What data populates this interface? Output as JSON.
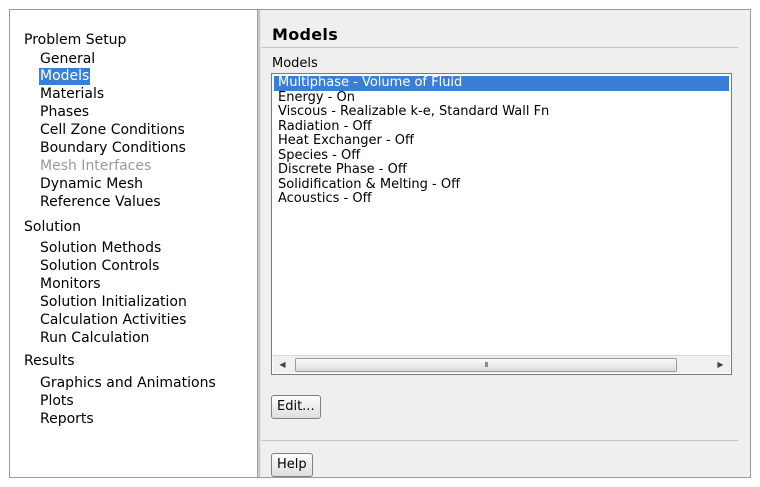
{
  "nav": {
    "sections": [
      {
        "label": "Problem Setup",
        "items": [
          {
            "label": "General",
            "state": "normal"
          },
          {
            "label": "Models",
            "state": "selected"
          },
          {
            "label": "Materials",
            "state": "normal"
          },
          {
            "label": "Phases",
            "state": "normal"
          },
          {
            "label": "Cell Zone Conditions",
            "state": "normal"
          },
          {
            "label": "Boundary Conditions",
            "state": "normal"
          },
          {
            "label": "Mesh Interfaces",
            "state": "disabled"
          },
          {
            "label": "Dynamic Mesh",
            "state": "normal"
          },
          {
            "label": "Reference Values",
            "state": "normal"
          }
        ]
      },
      {
        "label": "Solution",
        "items": [
          {
            "label": "Solution Methods",
            "state": "normal"
          },
          {
            "label": "Solution Controls",
            "state": "normal"
          },
          {
            "label": "Monitors",
            "state": "normal"
          },
          {
            "label": "Solution Initialization",
            "state": "normal"
          },
          {
            "label": "Calculation Activities",
            "state": "normal"
          },
          {
            "label": "Run Calculation",
            "state": "normal"
          }
        ]
      },
      {
        "label": "Results",
        "items": [
          {
            "label": "Graphics and Animations",
            "state": "normal"
          },
          {
            "label": "Plots",
            "state": "normal"
          },
          {
            "label": "Reports",
            "state": "normal"
          }
        ]
      }
    ]
  },
  "panel": {
    "title": "Models",
    "group_label": "Models",
    "models": [
      {
        "label": "Multiphase - Volume of Fluid",
        "selected": true
      },
      {
        "label": "Energy - On",
        "selected": false
      },
      {
        "label": "Viscous - Realizable k-e, Standard Wall Fn",
        "selected": false
      },
      {
        "label": "Radiation - Off",
        "selected": false
      },
      {
        "label": "Heat Exchanger - Off",
        "selected": false
      },
      {
        "label": "Species - Off",
        "selected": false
      },
      {
        "label": "Discrete Phase - Off",
        "selected": false
      },
      {
        "label": "Solidification & Melting - Off",
        "selected": false
      },
      {
        "label": "Acoustics - Off",
        "selected": false
      }
    ],
    "scroll_left_icon": "left-arrow-icon",
    "scroll_right_icon": "right-arrow-icon",
    "scroll_grip": "III",
    "edit_label": "Edit...",
    "help_label": "Help"
  },
  "colors": {
    "selection": "#3a7fd5",
    "panel_background": "#efefef",
    "disabled_text": "#9a9a9a"
  }
}
